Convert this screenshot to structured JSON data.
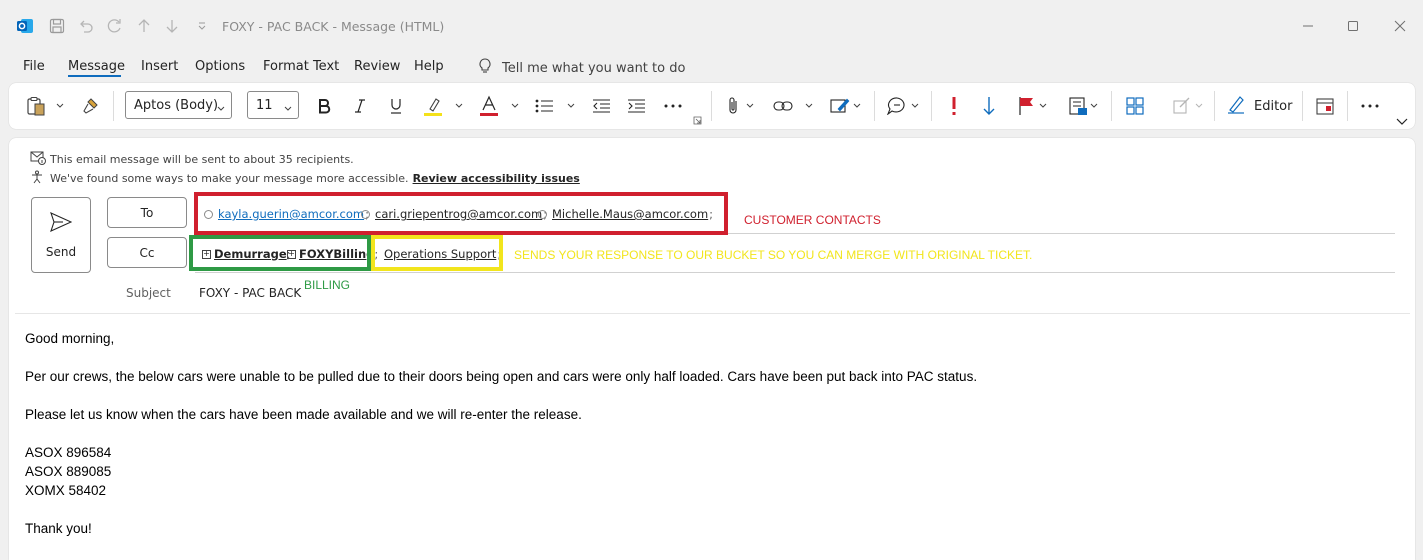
{
  "window": {
    "title": "FOXY - PAC BACK  -  Message (HTML)"
  },
  "menu": {
    "items": [
      "File",
      "Message",
      "Insert",
      "Options",
      "Format Text",
      "Review",
      "Help"
    ],
    "tell_me": "Tell me what you want to do"
  },
  "ribbon": {
    "font_name": "Aptos (Body)",
    "font_size": "11",
    "editor_label": "Editor"
  },
  "compose": {
    "info_recipients": "This email message will be sent to about 35 recipients.",
    "info_accessibility": "We've found some ways to make your message more accessible.",
    "accessibility_link": "Review accessibility issues",
    "send_label": "Send",
    "to_label": "To",
    "cc_label": "Cc",
    "subject_label": "Subject",
    "subject_value": "FOXY - PAC BACK",
    "to_recipients": [
      "kayla.guerin@amcor.com",
      "cari.griepentrog@amcor.com",
      "Michelle.Maus@amcor.com"
    ],
    "cc_groups": [
      "Demurrage",
      "FOXYBilling"
    ],
    "cc_recipient": "Operations Support"
  },
  "annotations": {
    "customer_contacts": "CUSTOMER CONTACTS",
    "billing": "BILLING",
    "bucket_note": "SENDS YOUR RESPONSE TO OUR BUCKET SO YOU CAN MERGE WITH ORIGINAL TICKET.",
    "colors": {
      "red": "#d0202e",
      "green": "#2e9a45",
      "yellow": "#f2e51c"
    }
  },
  "body": {
    "greeting": "Good morning,",
    "para1": "Per our crews, the below cars were unable to be pulled due to their doors being open and cars were only half loaded. Cars have been put back into PAC status.",
    "para2": "Please let us know when the cars have been made available and we will re-enter the release.",
    "cars": [
      "ASOX 896584",
      "ASOX 889085",
      "XOMX 58402"
    ],
    "closing": "Thank you!"
  }
}
